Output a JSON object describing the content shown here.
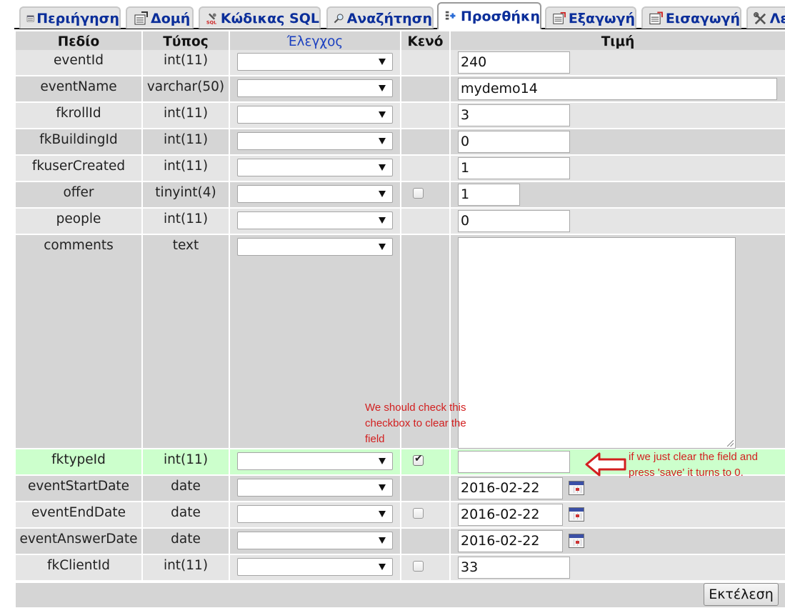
{
  "tabs": [
    {
      "label": "Περιήγηση",
      "icon": "browse-icon"
    },
    {
      "label": "Δομή",
      "icon": "structure-icon"
    },
    {
      "label": "Κώδικας SQL",
      "icon": "sql-icon"
    },
    {
      "label": "Αναζήτηση",
      "icon": "search-icon"
    },
    {
      "label": "Προσθήκη",
      "icon": "insert-icon",
      "active": true
    },
    {
      "label": "Εξαγωγή",
      "icon": "export-icon"
    },
    {
      "label": "Εισαγωγή",
      "icon": "import-icon"
    },
    {
      "label": "Λε",
      "icon": "operations-icon"
    }
  ],
  "table": {
    "headers": {
      "field": "Πεδίο",
      "type": "Τύπος",
      "function": "Έλεγχος",
      "null": "Κενό",
      "value": "Τιμή"
    },
    "rows": [
      {
        "field": "eventId",
        "type": "int(11)",
        "value": "240"
      },
      {
        "field": "eventName",
        "type": "varchar(50)",
        "value": "mydemo14"
      },
      {
        "field": "fkrollId",
        "type": "int(11)",
        "value": "3"
      },
      {
        "field": "fkBuildingId",
        "type": "int(11)",
        "value": "0"
      },
      {
        "field": "fkuserCreated",
        "type": "int(11)",
        "value": "1"
      },
      {
        "field": "offer",
        "type": "tinyint(4)",
        "value": "1",
        "null_checkbox": true,
        "null_checked": false
      },
      {
        "field": "people",
        "type": "int(11)",
        "value": "0"
      },
      {
        "field": "comments",
        "type": "text",
        "value": ""
      },
      {
        "field": "fktypeId",
        "type": "int(11)",
        "value": "",
        "null_checkbox": true,
        "null_checked": true
      },
      {
        "field": "eventStartDate",
        "type": "date",
        "value": "2016-02-22"
      },
      {
        "field": "eventEndDate",
        "type": "date",
        "value": "2016-02-22",
        "null_checkbox": true,
        "null_checked": false
      },
      {
        "field": "eventAnswerDate",
        "type": "date",
        "value": "2016-02-22"
      },
      {
        "field": "fkClientId",
        "type": "int(11)",
        "value": "33",
        "null_checkbox": true,
        "null_checked": false
      }
    ]
  },
  "buttons": {
    "execute": "Εκτέλεση"
  },
  "annotations": {
    "checkbox_note": [
      "We should check this",
      "checkbox to clear the",
      "field"
    ],
    "field_note": [
      "if we just clear the field and",
      "press 'save' it turns to 0."
    ]
  },
  "colors": {
    "annotation": "#d21f1f",
    "highlight_row": "#ccffcc",
    "tab_text": "#0b2e9a"
  }
}
